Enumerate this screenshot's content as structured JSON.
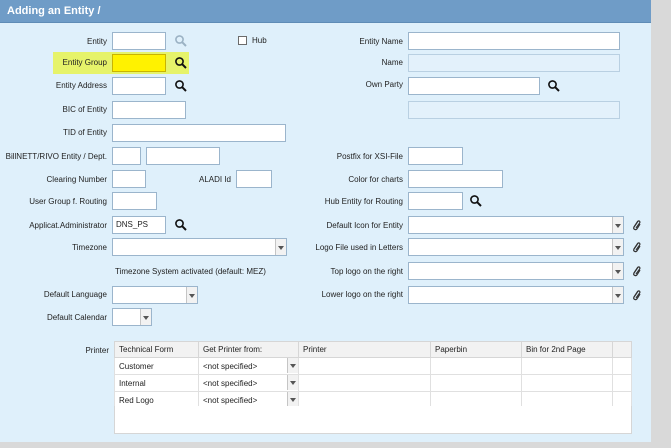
{
  "window": {
    "title": "Adding an Entity /"
  },
  "left": {
    "entity_label": "Entity",
    "entity_value": "",
    "hub_label": "Hub",
    "entity_group_label": "Entity Group",
    "entity_group_value": "",
    "entity_address_label": "Entity Address",
    "entity_address_value": "",
    "bic_label": "BIC of Entity",
    "bic_value": "",
    "tid_label": "TID of Entity",
    "tid_value": "",
    "billnett_label": "BillNETT/RIVO Entity / Dept.",
    "billnett_entity_value": "",
    "billnett_dept_value": "",
    "clearing_label": "Clearing Number",
    "clearing_value": "",
    "aladi_label": "ALADI Id",
    "aladi_value": "",
    "usergroup_label": "User Group f. Routing",
    "usergroup_value": "",
    "admin_label": "Applicat.Administrator",
    "admin_value": "DNS_PS",
    "timezone_label": "Timezone",
    "timezone_value": "",
    "timezone_note": "Timezone System activated (default: MEZ)",
    "language_label": "Default Language",
    "language_value": "",
    "calendar_label": "Default Calendar",
    "calendar_value": ""
  },
  "right": {
    "entity_name_label": "Entity Name",
    "entity_name_value": "",
    "name_label": "Name",
    "name_value": "",
    "own_party_label": "Own Party",
    "own_party_value": "",
    "own_party_detail": "",
    "postfix_label": "Postfix for XSI-File",
    "postfix_value": "",
    "color_label": "Color for charts",
    "color_value": "",
    "hub_routing_label": "Hub Entity for Routing",
    "hub_routing_value": "",
    "default_icon_label": "Default Icon for Entity",
    "default_icon_value": "",
    "logo_letters_label": "Logo File used in Letters",
    "logo_letters_value": "",
    "top_logo_label": "Top logo on the right",
    "top_logo_value": "",
    "lower_logo_label": "Lower logo on the right",
    "lower_logo_value": ""
  },
  "printer": {
    "label": "Printer",
    "columns": [
      "Technical Form",
      "Get Printer from:",
      "Printer",
      "Paperbin",
      "Bin for 2nd Page"
    ],
    "rows": [
      {
        "form": "Customer",
        "source": "<not specified>",
        "printer": "",
        "paperbin": "",
        "bin2": ""
      },
      {
        "form": "Internal",
        "source": "<not specified>",
        "printer": "",
        "paperbin": "",
        "bin2": ""
      },
      {
        "form": "Red Logo",
        "source": "<not specified>",
        "printer": "",
        "paperbin": "",
        "bin2": ""
      }
    ]
  },
  "icons": {
    "search": "magnifier-icon",
    "attach": "paperclip-icon",
    "dropdown": "chevron-down-icon"
  },
  "colors": {
    "titlebar": "#6f9cc7",
    "panel": "#dff0fb",
    "highlight": "#e6f36a",
    "required_field": "#fff200"
  }
}
